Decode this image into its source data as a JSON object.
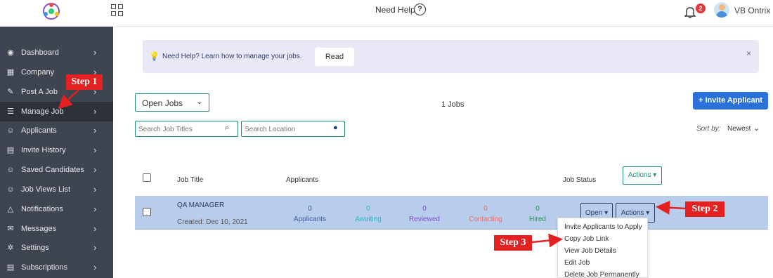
{
  "topbar": {
    "need_help": "Need Help",
    "help_icon_glyph": "?",
    "notification_count": "2",
    "username": "VB Ontrix"
  },
  "sidebar": {
    "items": [
      {
        "label": "Dashboard",
        "icon": "dashboard-icon",
        "glyph": "◉"
      },
      {
        "label": "Company",
        "icon": "building-icon",
        "glyph": "▦"
      },
      {
        "label": "Post A Job",
        "icon": "edit-icon",
        "glyph": "✎"
      },
      {
        "label": "Manage Job",
        "icon": "list-icon",
        "glyph": "☰",
        "active": true
      },
      {
        "label": "Applicants",
        "icon": "user-icon",
        "glyph": "☺"
      },
      {
        "label": "Invite History",
        "icon": "document-icon",
        "glyph": "▤"
      },
      {
        "label": "Saved Candidates",
        "icon": "user-check-icon",
        "glyph": "☺"
      },
      {
        "label": "Job Views List",
        "icon": "user-icon",
        "glyph": "☺"
      },
      {
        "label": "Notifications",
        "icon": "bell-icon",
        "glyph": "△"
      },
      {
        "label": "Messages",
        "icon": "envelope-icon",
        "glyph": "✉"
      },
      {
        "label": "Settings",
        "icon": "gear-icon",
        "glyph": "✲"
      },
      {
        "label": "Subscriptions",
        "icon": "subscription-icon",
        "glyph": "▤"
      }
    ],
    "chevron": "›"
  },
  "banner": {
    "text": "Need Help? Learn how to manage your jobs.",
    "read_label": "Read",
    "close_glyph": "×"
  },
  "toolbar": {
    "filter_value": "Open Jobs",
    "jobs_count": "1 Jobs",
    "invite_label": "+ Invite Applicant",
    "search_titles_placeholder": "Search Job Titles",
    "search_location_placeholder": "Search Location",
    "sort_by_label": "Sort by:",
    "sort_value": "Newest"
  },
  "table": {
    "headers": {
      "job_title": "Job Title",
      "applicants": "Applicants",
      "job_status": "Job Status",
      "actions": "Actions"
    },
    "rows": [
      {
        "title": "QA MANAGER",
        "created": "Created: Dec 10, 2021",
        "stats": [
          {
            "value": "0",
            "label": "Applicants",
            "color": "#4a5aa8"
          },
          {
            "value": "0",
            "label": "Awaiting",
            "color": "#2fb3c4"
          },
          {
            "value": "0",
            "label": "Reviewed",
            "color": "#7a52c7"
          },
          {
            "value": "0",
            "label": "Contacting",
            "color": "#ef6b6b"
          },
          {
            "value": "0",
            "label": "Hired",
            "color": "#2f8f4e"
          }
        ],
        "status_label": "Open",
        "actions_label": "Actions"
      }
    ]
  },
  "dropdown": {
    "items": [
      "Invite Applicants to Apply",
      "Copy Job Link",
      "View Job Details",
      "Edit Job",
      "Delete Job Permanently"
    ]
  },
  "annotations": {
    "step1": "Step 1",
    "step2": "Step 2",
    "step3": "Step 3",
    "color": "#e52020"
  }
}
